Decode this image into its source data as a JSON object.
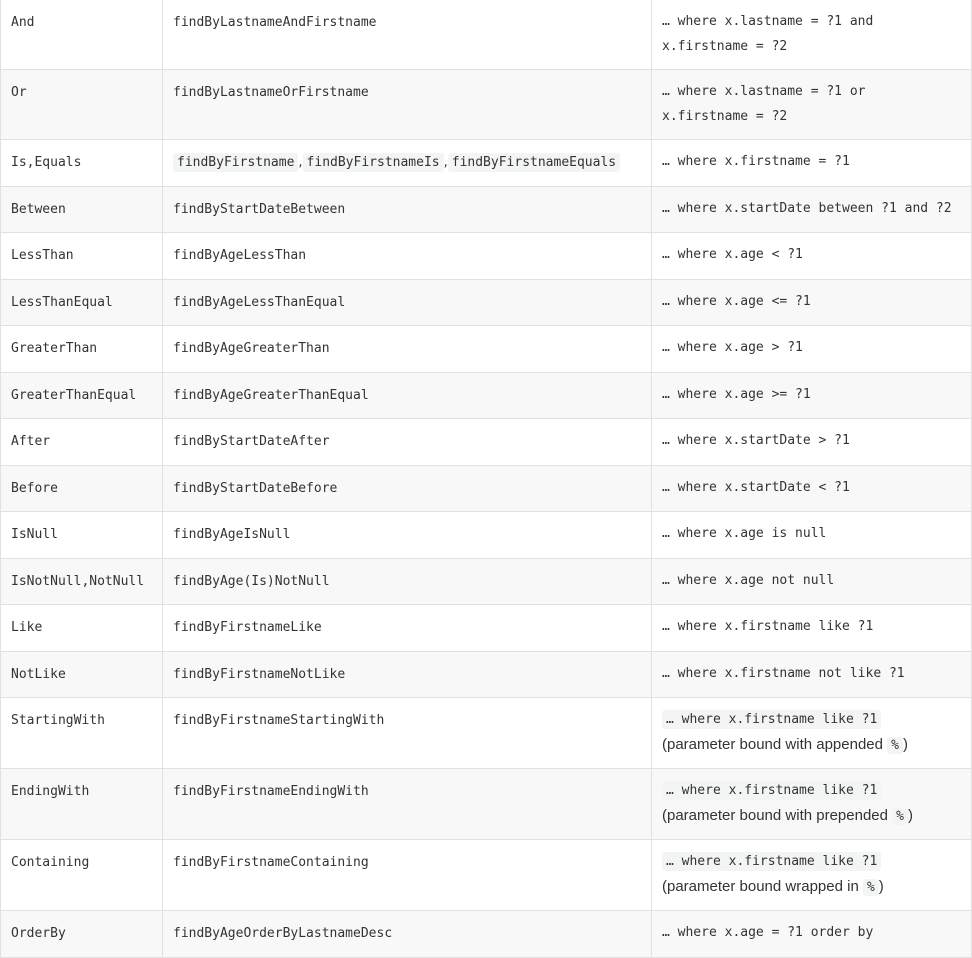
{
  "rows": [
    {
      "keyword": "And",
      "method": "findByLastnameAndFirstname",
      "jpql": [
        "… where x.lastname = ?1 and",
        "x.firstname = ?2"
      ]
    },
    {
      "keyword": "Or",
      "method": "findByLastnameOrFirstname",
      "jpql": [
        "… where x.lastname = ?1 or",
        "x.firstname = ?2"
      ]
    },
    {
      "keyword": "Is,Equals",
      "methods": [
        "findByFirstname",
        "findByFirstnameIs",
        "findByFirstnameEquals"
      ],
      "separator": ",",
      "jpql": [
        "… where x.firstname = ?1"
      ]
    },
    {
      "keyword": "Between",
      "method": "findByStartDateBetween",
      "jpql": [
        "… where x.startDate between ?1 and ?2"
      ]
    },
    {
      "keyword": "LessThan",
      "method": "findByAgeLessThan",
      "jpql": [
        "… where x.age < ?1"
      ]
    },
    {
      "keyword": "LessThanEqual",
      "method": "findByAgeLessThanEqual",
      "jpql": [
        "… where x.age <= ?1"
      ]
    },
    {
      "keyword": "GreaterThan",
      "method": "findByAgeGreaterThan",
      "jpql": [
        "… where x.age > ?1"
      ]
    },
    {
      "keyword": "GreaterThanEqual",
      "method": "findByAgeGreaterThanEqual",
      "jpql": [
        "… where x.age >= ?1"
      ]
    },
    {
      "keyword": "After",
      "method": "findByStartDateAfter",
      "jpql": [
        "… where x.startDate > ?1"
      ]
    },
    {
      "keyword": "Before",
      "method": "findByStartDateBefore",
      "jpql": [
        "… where x.startDate < ?1"
      ]
    },
    {
      "keyword": "IsNull",
      "method": "findByAgeIsNull",
      "jpql": [
        "… where x.age is null"
      ]
    },
    {
      "keyword": "IsNotNull,NotNull",
      "method": "findByAge(Is)NotNull",
      "jpql": [
        "… where x.age not null"
      ]
    },
    {
      "keyword": "Like",
      "method": "findByFirstnameLike",
      "jpql": [
        "… where x.firstname like ?1"
      ]
    },
    {
      "keyword": "NotLike",
      "method": "findByFirstnameNotLike",
      "jpql": [
        "… where x.firstname not like ?1"
      ]
    },
    {
      "keyword": "StartingWith",
      "method": "findByFirstnameStartingWith",
      "jpql_code": "… where x.firstname like ?1",
      "note_prefix": "(parameter bound with appended ",
      "note_symbol": "%",
      "note_suffix": ")"
    },
    {
      "keyword": "EndingWith",
      "method": "findByFirstnameEndingWith",
      "jpql_code": "… where x.firstname like ?1",
      "note_prefix": "(parameter bound with prepended ",
      "note_symbol": "%",
      "note_suffix": ")"
    },
    {
      "keyword": "Containing",
      "method": "findByFirstnameContaining",
      "jpql_code": "… where x.firstname like ?1",
      "note_prefix": "(parameter bound wrapped in ",
      "note_symbol": "%",
      "note_suffix": ")"
    },
    {
      "keyword": "OrderBy",
      "method": "findByAgeOrderByLastnameDesc",
      "jpql": [
        "… where x.age = ?1 order by"
      ]
    }
  ]
}
